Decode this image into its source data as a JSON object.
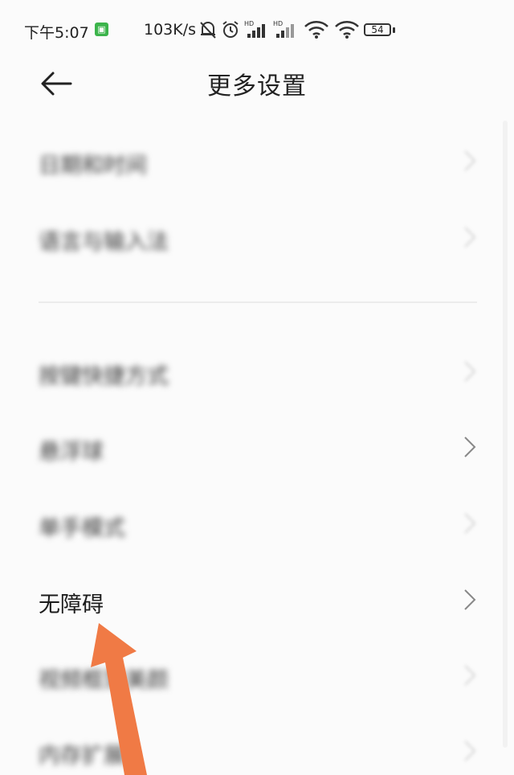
{
  "status_bar": {
    "time": "下午5:07",
    "net_speed": "103K/s",
    "battery": "54",
    "icons": [
      "app-icon",
      "mute-bell-icon",
      "alarm-icon",
      "hd-signal-icon",
      "hd-signal-icon",
      "wifi-icon",
      "wifi-icon",
      "battery-icon"
    ]
  },
  "header": {
    "title": "更多设置",
    "back_icon": "back-arrow-icon"
  },
  "list": {
    "item_0": "日期和时间",
    "item_1": "语言与输入法",
    "item_2": "按键快捷方式",
    "item_3": "悬浮球",
    "item_4": "单手模式",
    "item_5": "无障碍",
    "item_6": "视频框架美颜",
    "item_7": "内存扩展"
  },
  "annotation": {
    "arrow_color": "#f07a45"
  }
}
